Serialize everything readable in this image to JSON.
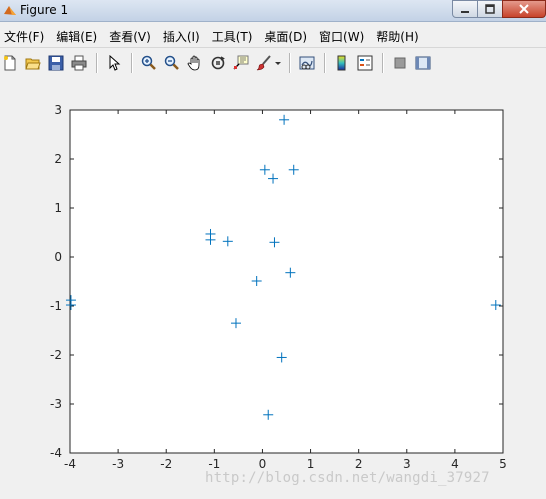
{
  "window": {
    "title": "Figure 1",
    "app_icon": "matlab-logo-icon",
    "buttons": {
      "minimize": "minimize-icon",
      "maximize": "maximize-icon",
      "close": "close-icon"
    }
  },
  "menu": {
    "items": [
      {
        "label": "文件(F)"
      },
      {
        "label": "编辑(E)"
      },
      {
        "label": "查看(V)"
      },
      {
        "label": "插入(I)"
      },
      {
        "label": "工具(T)"
      },
      {
        "label": "桌面(D)"
      },
      {
        "label": "窗口(W)"
      },
      {
        "label": "帮助(H)"
      }
    ]
  },
  "toolbar": {
    "icons": [
      "new-figure-icon",
      "open-file-icon",
      "save-icon",
      "print-icon",
      "edit-plot-arrow-icon",
      "zoom-in-icon",
      "zoom-out-icon",
      "pan-hand-icon",
      "rotate-3d-icon",
      "data-cursor-icon",
      "brush-icon",
      "brush-dropdown-icon",
      "link-plot-icon",
      "colorbar-icon",
      "legend-icon",
      "hide-plot-tools-icon",
      "show-plot-tools-icon"
    ]
  },
  "watermark": "http://blog.csdn.net/wangdi_37927",
  "chart_data": {
    "type": "scatter",
    "marker": "+",
    "color": "#0072bd",
    "xlim": [
      -4,
      5
    ],
    "ylim": [
      -4,
      3
    ],
    "x_ticks": [
      "-4",
      "-3",
      "-2",
      "-1",
      "0",
      "1",
      "2",
      "3",
      "4",
      "5"
    ],
    "y_ticks": [
      "3",
      "2",
      "1",
      "0",
      "-1",
      "-2",
      "-3",
      "-4"
    ],
    "grid": false,
    "points": [
      {
        "x": 0.45,
        "y": 2.8
      },
      {
        "x": 0.05,
        "y": 1.78
      },
      {
        "x": 0.65,
        "y": 1.78
      },
      {
        "x": 0.22,
        "y": 1.6
      },
      {
        "x": -1.08,
        "y": 0.47
      },
      {
        "x": -1.08,
        "y": 0.35
      },
      {
        "x": -0.72,
        "y": 0.32
      },
      {
        "x": 0.25,
        "y": 0.3
      },
      {
        "x": 0.58,
        "y": -0.32
      },
      {
        "x": -0.12,
        "y": -0.49
      },
      {
        "x": -3.98,
        "y": -0.88
      },
      {
        "x": -3.98,
        "y": -0.98
      },
      {
        "x": 4.85,
        "y": -0.98
      },
      {
        "x": -0.55,
        "y": -1.35
      },
      {
        "x": 0.4,
        "y": -2.05
      },
      {
        "x": 0.12,
        "y": -3.22
      }
    ]
  }
}
